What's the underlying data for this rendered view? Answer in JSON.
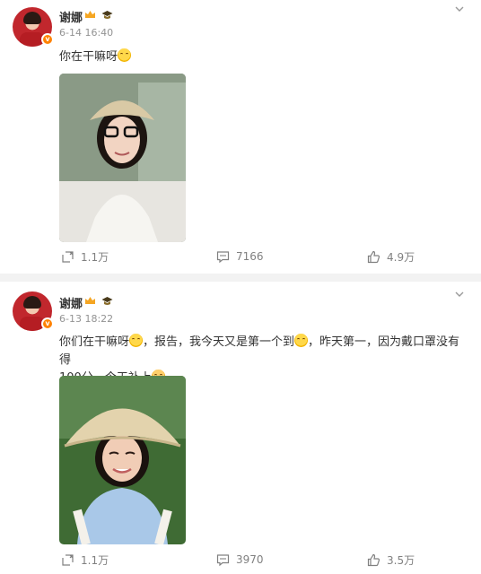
{
  "posts": [
    {
      "author": "谢娜",
      "time": "6-14 16:40",
      "text": "你在干嘛呀",
      "actions": {
        "repost": "1.1万",
        "comment": "7166",
        "like": "4.9万"
      }
    },
    {
      "author": "谢娜",
      "time": "6-13 18:22",
      "text_line1_a": "你们在干嘛呀",
      "text_line1_b": "，报告，我今天又是第一个到",
      "text_line1_c": "，昨天第一，因为戴口罩没有得",
      "text_line2": "100分，今天补上",
      "actions": {
        "repost": "1.1万",
        "comment": "3970",
        "like": "3.5万"
      }
    }
  ],
  "icons": {
    "verified": "v-badge",
    "crown": "crown-icon",
    "cap": "graduation-cap-icon",
    "repost": "repost-icon",
    "comment": "comment-icon",
    "like": "thumbs-up-icon",
    "more": "chevron-down-icon"
  },
  "colors": {
    "verified_badge": "#ff8200",
    "meta_gray": "#939393",
    "action_gray": "#808080"
  }
}
